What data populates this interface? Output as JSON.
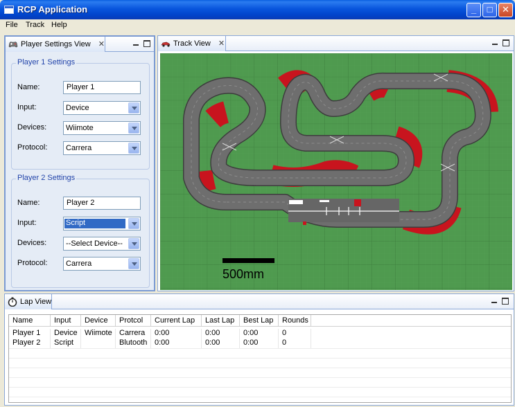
{
  "window": {
    "title": "RCP Application",
    "buttons": {
      "minimize": "_",
      "maximize": "□",
      "close": "✕"
    }
  },
  "menu": [
    "File",
    "Track",
    "Help"
  ],
  "player_view": {
    "tab_label": "Player Settings View",
    "close_glyph": "✕",
    "player1": {
      "title": "Player 1 Settings",
      "name_label": "Name:",
      "name_value": "Player 1",
      "input_label": "Input:",
      "input_value": "Device",
      "devices_label": "Devices:",
      "devices_value": "Wiimote",
      "protocol_label": "Protocol:",
      "protocol_value": "Carrera"
    },
    "player2": {
      "title": "Player 2 Settings",
      "name_label": "Name:",
      "name_value": "Player 2",
      "input_label": "Input:",
      "input_value": "Script",
      "devices_label": "Devices:",
      "devices_value": "--Select Device--",
      "protocol_label": "Protocol:",
      "protocol_value": "Carrera"
    }
  },
  "track_view": {
    "tab_label": "Track View",
    "close_glyph": "✕",
    "scale_label": "500mm",
    "colors": {
      "grass": "#4f9a4f",
      "grid": "#3c7d3c",
      "asphalt": "#6e6e6e",
      "curb_red": "#c8141e",
      "curb_white": "#ffffff"
    }
  },
  "lap_view": {
    "tab_label": "Lap View",
    "columns": [
      "Name",
      "Input",
      "Device",
      "Protcol",
      "Current Lap",
      "Last Lap",
      "Best Lap",
      "Rounds"
    ],
    "rows": [
      [
        "Player 1",
        "Device",
        "Wiimote",
        "Carrera",
        "0:00",
        "0:00",
        "0:00",
        "0"
      ],
      [
        "Player 2",
        "Script",
        "",
        "Blutooth",
        "0:00",
        "0:00",
        "0:00",
        "0"
      ]
    ]
  }
}
